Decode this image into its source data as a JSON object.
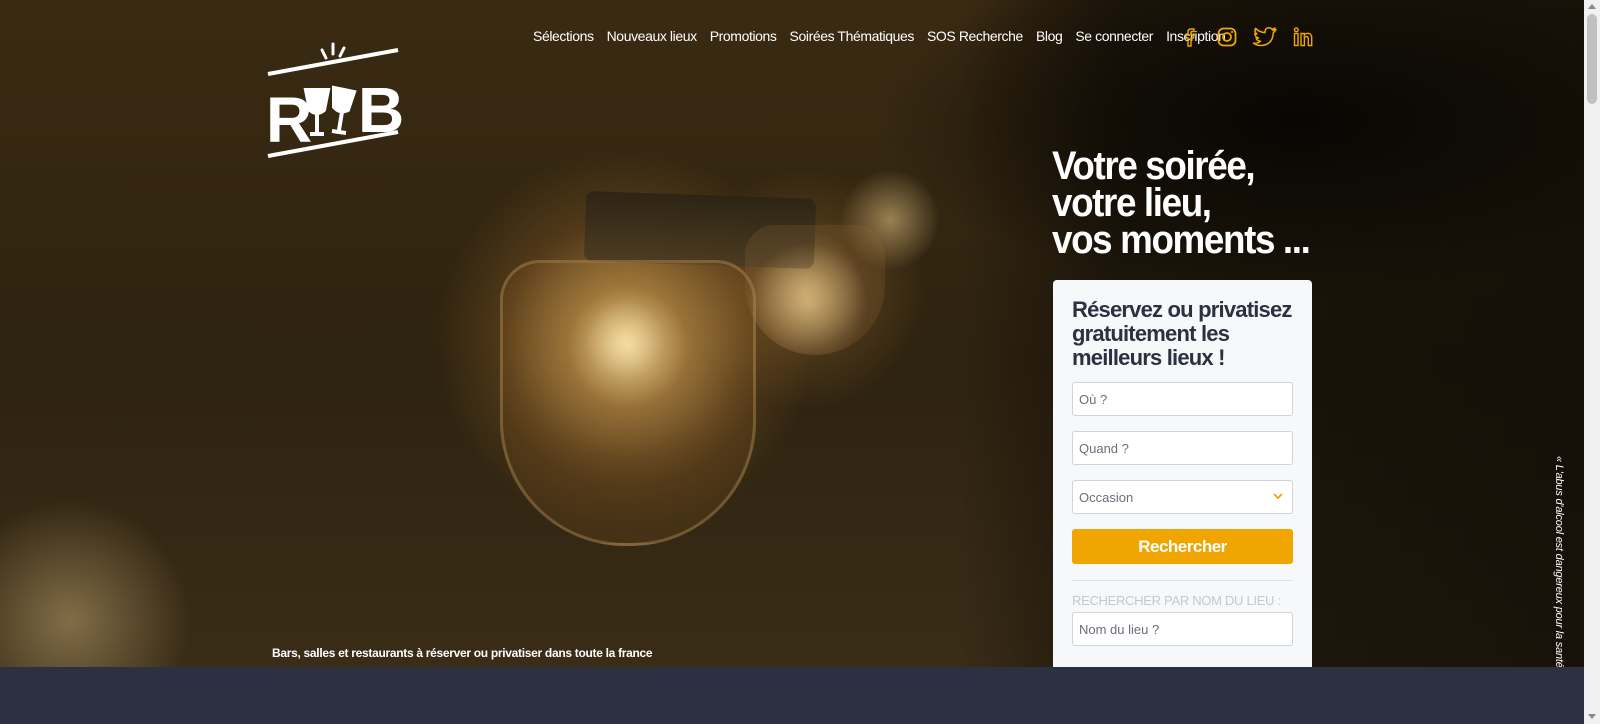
{
  "nav": {
    "items": [
      "Sélections",
      "Nouveaux lieux",
      "Promotions",
      "Soirées Thématiques",
      "SOS Recherche",
      "Blog",
      "Se connecter",
      "Inscription"
    ]
  },
  "social": {
    "icons": [
      "facebook-icon",
      "instagram-icon",
      "twitter-icon",
      "linkedin-icon"
    ],
    "color": "#f0a500"
  },
  "logo": {
    "text": "RB"
  },
  "hero": {
    "headline": [
      "Votre soirée,",
      "votre lieu,",
      "vos moments ..."
    ],
    "tagline": "Bars, salles et restaurants à réserver ou privatiser dans toute la france",
    "disclaimer": "« L'abus d'alcool est dangereux pour la santé »."
  },
  "search_card": {
    "title": "Réservez ou privatisez gratuitement les meilleurs lieux !",
    "where_placeholder": "Où ?",
    "when_placeholder": "Quand ?",
    "occasion_selected": "Occasion",
    "submit_label": "Rechercher",
    "name_search_label": "RECHERCHER PAR NOM DU LIEU :",
    "name_placeholder": "Nom du lieu ?"
  },
  "colors": {
    "accent": "#f0a500",
    "card_bg": "#f7f8fa",
    "dark_band": "#2b3140"
  }
}
